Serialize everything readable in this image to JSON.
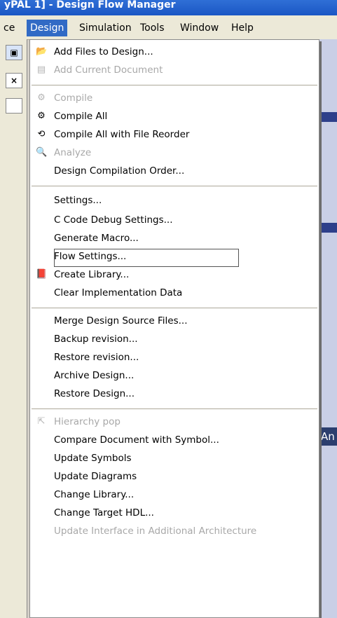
{
  "window": {
    "title": "yPAL 1] - Design Flow Manager"
  },
  "menubar": {
    "items": [
      {
        "label": "ce"
      },
      {
        "label": "Design"
      },
      {
        "label": "Simulation"
      },
      {
        "label": "Tools"
      },
      {
        "label": "Window"
      },
      {
        "label": "Help"
      }
    ]
  },
  "background": {
    "right_label": "An"
  },
  "design_menu": {
    "items": [
      {
        "label": "Add Files to Design...",
        "icon": "add-files-icon"
      },
      {
        "label": "Add Current Document",
        "icon": "add-current-document-icon"
      },
      {
        "label": "Compile",
        "icon": "compile-icon"
      },
      {
        "label": "Compile All",
        "icon": "compile-all-icon"
      },
      {
        "label": "Compile All with File Reorder",
        "icon": "compile-reorder-icon"
      },
      {
        "label": "Analyze",
        "icon": "analyze-icon"
      },
      {
        "label": "Design Compilation Order..."
      },
      {
        "label": "Settings..."
      },
      {
        "label": "C Code Debug Settings..."
      },
      {
        "label": "Generate Macro..."
      },
      {
        "label": "Flow Settings..."
      },
      {
        "label": "Create Library...",
        "icon": "create-library-icon"
      },
      {
        "label": "Clear Implementation Data"
      },
      {
        "label": "Merge Design Source Files..."
      },
      {
        "label": "Backup revision..."
      },
      {
        "label": "Restore revision..."
      },
      {
        "label": "Archive Design..."
      },
      {
        "label": "Restore Design..."
      },
      {
        "label": "Hierarchy pop",
        "icon": "hierarchy-pop-icon"
      },
      {
        "label": "Compare Document with Symbol..."
      },
      {
        "label": "Update Symbols"
      },
      {
        "label": "Update Diagrams"
      },
      {
        "label": "Change Library..."
      },
      {
        "label": "Change Target HDL..."
      },
      {
        "label": "Update Interface in Additional Architecture"
      }
    ]
  }
}
